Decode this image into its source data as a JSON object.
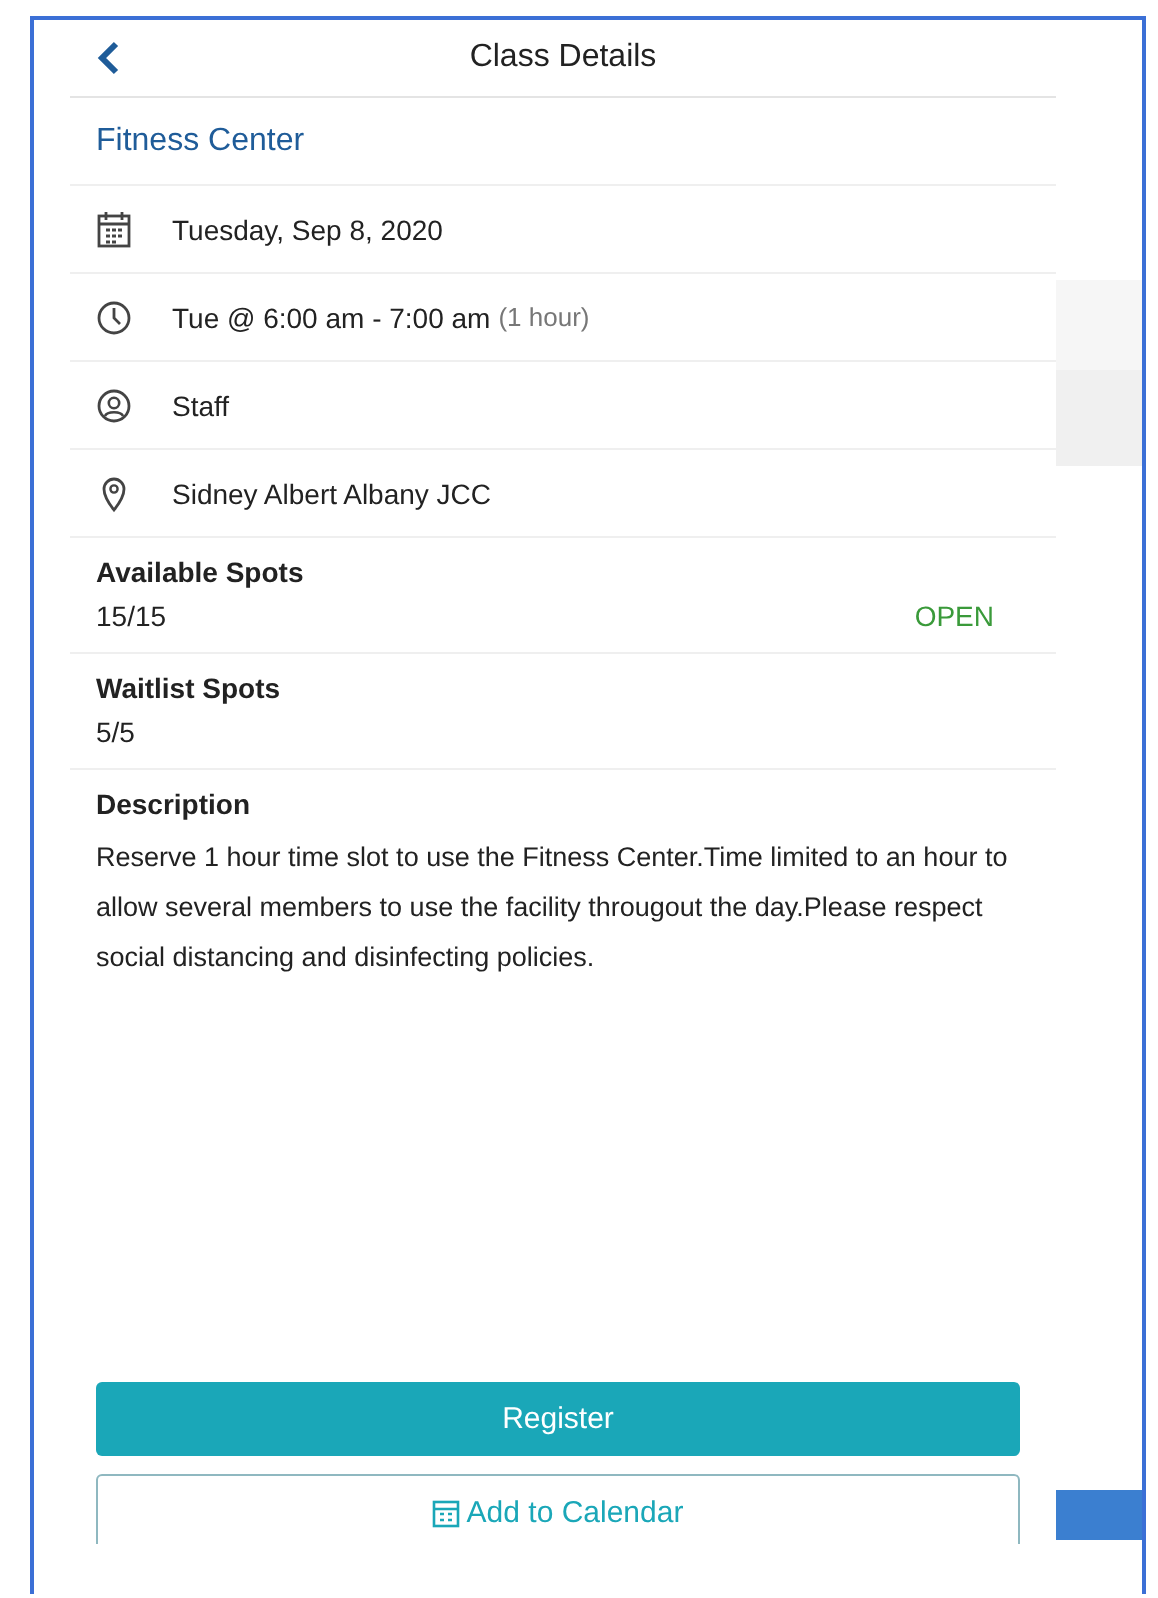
{
  "header": {
    "title": "Class Details"
  },
  "class_name": "Fitness Center",
  "info_rows": [
    {
      "kind": "date",
      "text": "Tuesday, Sep 8, 2020"
    },
    {
      "kind": "time",
      "text": "Tue @ 6:00 am - 7:00 am",
      "note": "(1 hour)"
    },
    {
      "kind": "instructor",
      "text": "Staff"
    },
    {
      "kind": "location",
      "text": "Sidney Albert Albany JCC"
    }
  ],
  "available_spots": {
    "label": "Available Spots",
    "value": "15/15",
    "status": "OPEN"
  },
  "waitlist_spots": {
    "label": "Waitlist Spots",
    "value": "5/5"
  },
  "description": {
    "label": "Description",
    "text": "Reserve 1 hour time slot to use the Fitness Center.Time limited to an hour to allow several members to use the facility througout the day.Please respect social distancing and disinfecting policies."
  },
  "buttons": [
    {
      "kind": "primary",
      "label": "Register"
    },
    {
      "kind": "outline",
      "label": "Add to Calendar"
    }
  ]
}
